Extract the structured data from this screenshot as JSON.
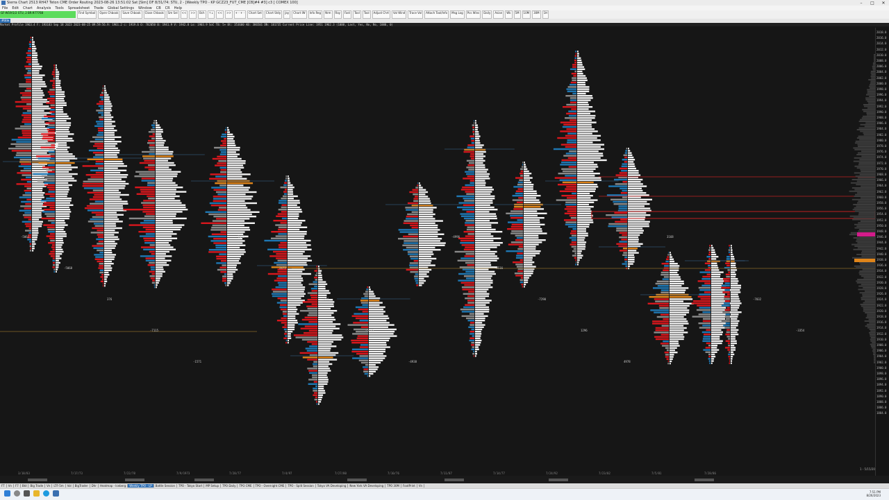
{
  "titlebar": {
    "text": "Sierra Chart 2513 RH47 Teton CME Order Routing 2023-08-26 13:51:02 Sat [Sim] DF 8/31/74: STU, 2 - [Weekly TPO - KP GCZ23_FUT_CME [CB]#4 #3] c3 [ COMEX 100]"
  },
  "menubar": {
    "items": [
      "File",
      "Edit",
      "Chart",
      "Analysis",
      "Tools",
      "Spreadsheet",
      "Trade",
      "Global Settings",
      "Window",
      "CB",
      "CR",
      "Help"
    ]
  },
  "toolbar": {
    "symbol_text": "GF-W19/1/2 STU, 2 BR:977768",
    "buttons": [
      "Find Symbol",
      "Open Chbook",
      "Save Chbook",
      "Close Chbook",
      "Sm Sel",
      "<<",
      ">>",
      "Bch",
      "↑↓",
      "<<",
      ">>",
      "+ - + -",
      "Chart Set",
      "Chart Stdy",
      "Jay",
      "Chart IW",
      "Info Reg",
      "Nrm",
      "Ray",
      "Fast",
      "Tool",
      "Tool",
      "Adjust Chrt",
      "Val Wind",
      "Trace Vol",
      "Attach Tool/Info",
      "Msg Log",
      "Pcs Wins",
      "Daily",
      "Asian",
      "Wk",
      "5M",
      "10M",
      "30M",
      "1H"
    ]
  },
  "chart_tab": "#title",
  "info_line": "Market Profile  1963.4  F: 193183  Sep 18 2023  2023-08-25 09:59:56.9: 1961.2 c: 1919.6 O: 782050 B: 1941.9 V: 1942.8 Lo: 1903.9 SoC TB: 5+ Bt: 353600 AB: 386501 DN: 181735 Current Price Line: 1951  1962.3   (1000, Last, Yes, No, No, 1000, 0)",
  "price_labels": [
    "2018.0",
    "2016.0",
    "2014.0",
    "2012.0",
    "2010.0",
    "2008.0",
    "2006.0",
    "2004.0",
    "2002.0",
    "2000.0",
    "1998.0",
    "1996.0",
    "1994.0",
    "1992.0",
    "1990.0",
    "1988.0",
    "1986.0",
    "1984.0",
    "1982.0",
    "1980.0",
    "1978.0",
    "1976.0",
    "1974.0",
    "1972.0",
    "1970.0",
    "1968.0",
    "1966.0",
    "1964.0",
    "1962.0",
    "1960.0",
    "1958.0",
    "1956.0",
    "1954.0",
    "1952.0",
    "1950.0",
    "1948.0",
    "1946.0",
    "1944.0",
    "1942.0",
    "1940.0",
    "1938.0",
    "1936.0",
    "1934.0",
    "1932.0",
    "1930.0",
    "1928.0",
    "1926.0",
    "1924.0",
    "1922.0",
    "1920.0",
    "1918.0",
    "1916.0",
    "1914.0",
    "1912.0",
    "1910.0",
    "1908.0",
    "1906.0",
    "1904.0",
    "1902.0",
    "1900.0",
    "1898.0",
    "1896.0",
    "1894.0",
    "1892.0",
    "1890.0",
    "1888.0",
    "1886.0",
    "1884.0"
  ],
  "date_labels": [
    "3/18/83",
    "7/17/73",
    "7/22/78",
    "7/9/1973",
    "7/28/77",
    "7/4/97",
    "7/27/80",
    "7/10/76",
    "7/11/87",
    "7/14/77",
    "7/24/92",
    "7/23/02",
    "7/5/81",
    "7/28/86"
  ],
  "profile_labels": [
    "-5063",
    "-5068",
    "376",
    "-7115",
    "-1571",
    "-7073",
    "2473",
    "-216",
    "-5235",
    "-4938",
    "-4996",
    "-5516",
    "-7290",
    "1296",
    "4978",
    "3168",
    "-1016",
    "-7032",
    "-3354"
  ],
  "colors": {
    "tpo_white": "#f2f2f2",
    "tpo_grey": "#8a8a8a",
    "vol_red": "#d8171d",
    "vol_blue": "#1f78b4",
    "poc_orange": "#e0851a",
    "level_line": "#c02020",
    "magenta": "#d21c8a"
  },
  "bottom_tabs": [
    "FT",
    "Vn",
    "F7",
    "Bkt",
    "Big Trade",
    "Vn",
    "LTF-5m",
    "Vol",
    "BigTrader",
    "Dhr",
    "Heatmap - Iceberg",
    "Weekly TPO - LP",
    "Battle Session",
    "TPO - Tokyo Start",
    "MP Setup",
    "TPO Daily",
    "TPO CME",
    "TPO - Overnight CME",
    "TPO - Split Session",
    "Tokyo VA Developing",
    "New York VA Developing",
    "TPO 30M",
    "FootPrint",
    "Vn"
  ],
  "active_tab": "Weekly TPO - LP",
  "tray": {
    "time": "7:51 PM",
    "date": "8/26/2023"
  },
  "status_right": "1 - 5/15/2023\nPrf: 1948.8"
}
